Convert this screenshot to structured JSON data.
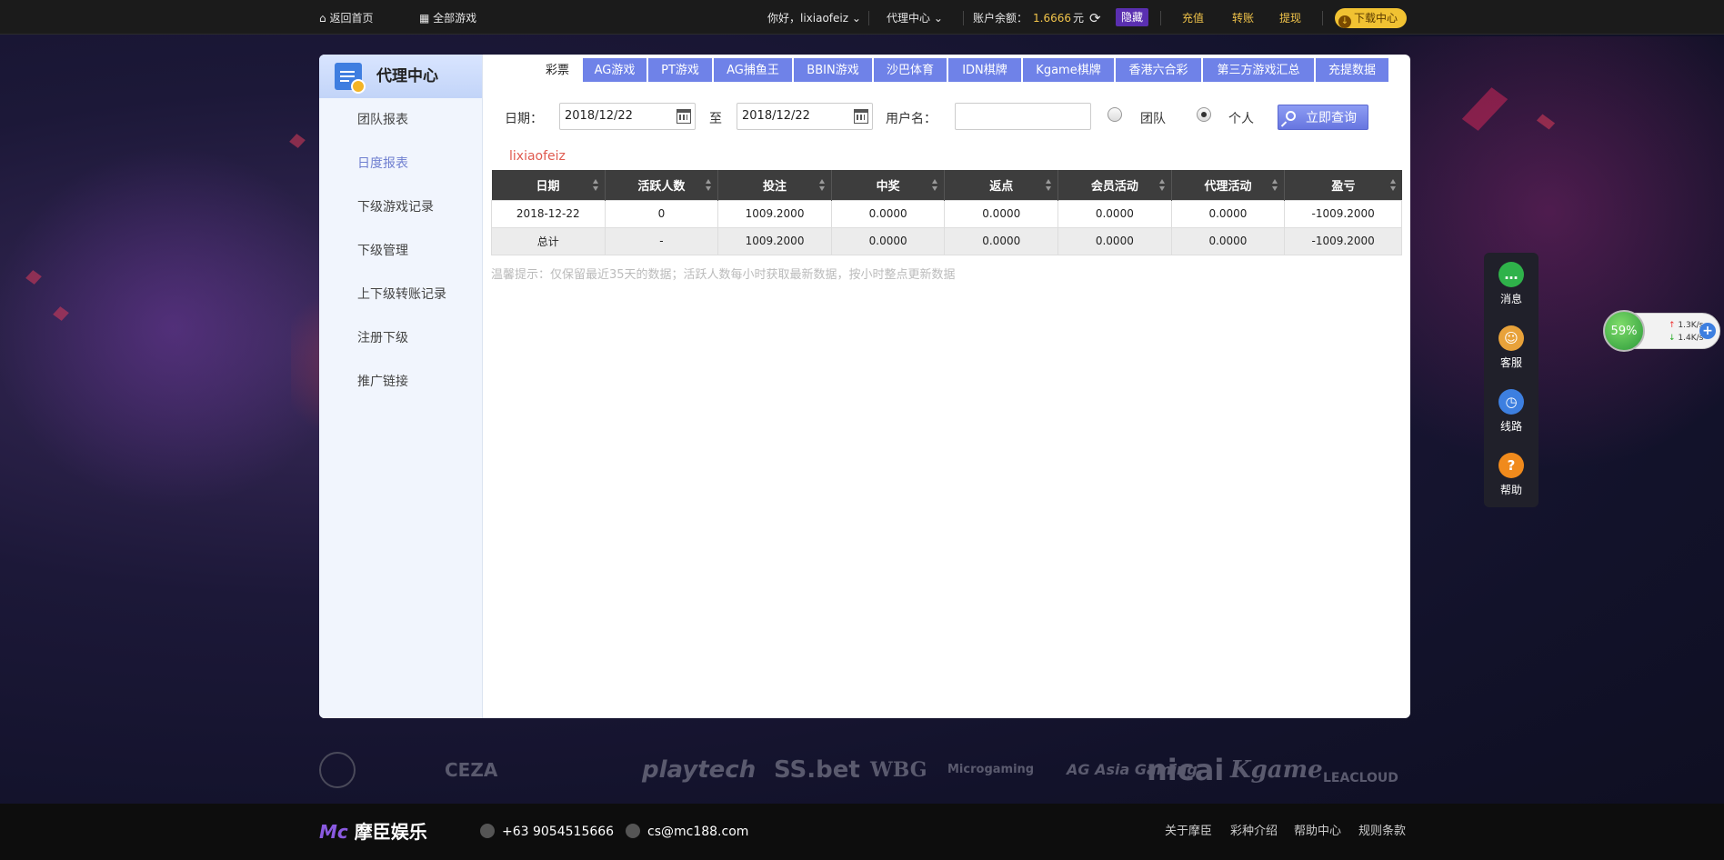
{
  "topbar": {
    "home": "返回首页",
    "all_games": "全部游戏",
    "greeting": "你好，lixiaofeiz",
    "agent_center": "代理中心",
    "balance_label": "账户余额：",
    "balance_value": "1.6666",
    "balance_unit": "元",
    "hide": "隐藏",
    "recharge": "充值",
    "transfer": "转账",
    "withdraw": "提现",
    "download": "下载中心"
  },
  "sidebar": {
    "title": "代理中心",
    "items": [
      {
        "label": "团队报表"
      },
      {
        "label": "日度报表"
      },
      {
        "label": "下级游戏记录"
      },
      {
        "label": "下级管理"
      },
      {
        "label": "上下级转账记录"
      },
      {
        "label": "注册下级"
      },
      {
        "label": "推广链接"
      }
    ]
  },
  "tabs": [
    "彩票",
    "AG游戏",
    "PT游戏",
    "AG捕鱼王",
    "BBIN游戏",
    "沙巴体育",
    "IDN棋牌",
    "Kgame棋牌",
    "香港六合彩",
    "第三方游戏汇总",
    "充提数据"
  ],
  "filter": {
    "date_label": "日期：",
    "date_from": "2018/12/22",
    "to": "至",
    "date_to": "2018/12/22",
    "username_label": "用户名：",
    "username_value": "",
    "team": "团队",
    "personal": "个人",
    "search": "立即查询"
  },
  "current_user": "lixiaofeiz",
  "table": {
    "columns": [
      "日期",
      "活跃人数",
      "投注",
      "中奖",
      "返点",
      "会员活动",
      "代理活动",
      "盈亏"
    ],
    "rows": [
      [
        "2018-12-22",
        "0",
        "1009.2000",
        "0.0000",
        "0.0000",
        "0.0000",
        "0.0000",
        "-1009.2000"
      ]
    ],
    "total": [
      "总计",
      "-",
      "1009.2000",
      "0.0000",
      "0.0000",
      "0.0000",
      "0.0000",
      "-1009.2000"
    ]
  },
  "hint": "温馨提示：仅保留最近35天的数据；活跃人数每小时获取最新数据，按小时整点更新数据",
  "partners": [
    "CEZA",
    "playtech",
    "SS.bet",
    "WBG",
    "Microgaming",
    "AG Asia Gaming",
    "nicai",
    "Kgame",
    "LEACLOUD"
  ],
  "footer": {
    "brand": "摩臣娱乐",
    "phone": "+63 9054515666",
    "email": "cs@mc188.com",
    "links": [
      "关于摩臣",
      "彩种介绍",
      "帮助中心",
      "规则条款"
    ]
  },
  "float": {
    "items": [
      "消息",
      "客服",
      "线路",
      "帮助"
    ]
  },
  "net": {
    "percent": "59%",
    "up": "1.3K/s",
    "down": "1.4K/s"
  },
  "colors": {
    "accent": "#6f82e8",
    "gold": "#f0c34a",
    "loss_user": "#e05a4f"
  }
}
